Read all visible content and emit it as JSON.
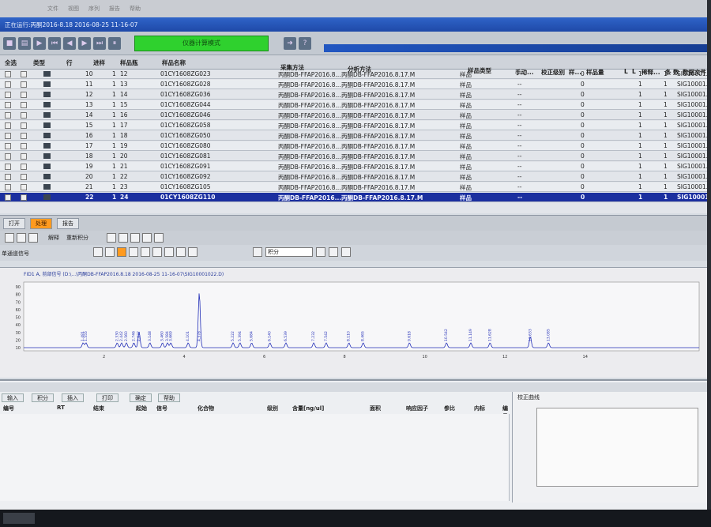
{
  "window": {
    "title": "正在运行:丙酮2016-8.18 2016-08-25 11-16-07",
    "mode_label": "仪器计算模式"
  },
  "grid": {
    "headers": [
      "全选",
      "类型",
      "行",
      "进样",
      "样品瓶",
      "样品名称",
      "采集方法",
      "分析方法",
      "样品类型",
      "手动...",
      "校正级别",
      "样...",
      "样品量",
      "L",
      "L",
      "稀释...",
      "条",
      "数",
      "数据文件"
    ],
    "rows": [
      {
        "line": "10",
        "inj": "1",
        "vial": "12",
        "name": "01CY1608ZG023",
        "acq": "丙酮DB-FFAP2016.8...",
        "ana": "丙酮DB-FFAP2016.8.17.M",
        "type": "样品",
        "amt": "0",
        "f1": "1",
        "f2": "1",
        "file": "SIG10001..."
      },
      {
        "line": "11",
        "inj": "1",
        "vial": "13",
        "name": "01CY1608ZG028",
        "acq": "丙酮DB-FFAP2016.8...",
        "ana": "丙酮DB-FFAP2016.8.17.M",
        "type": "样品",
        "amt": "0",
        "f1": "1",
        "f2": "1",
        "file": "SIG10001..."
      },
      {
        "line": "12",
        "inj": "1",
        "vial": "14",
        "name": "01CY1608ZG036",
        "acq": "丙酮DB-FFAP2016.8...",
        "ana": "丙酮DB-FFAP2016.8.17.M",
        "type": "样品",
        "amt": "0",
        "f1": "1",
        "f2": "1",
        "file": "SIG10001..."
      },
      {
        "line": "13",
        "inj": "1",
        "vial": "15",
        "name": "01CY1608ZG044",
        "acq": "丙酮DB-FFAP2016.8...",
        "ana": "丙酮DB-FFAP2016.8.17.M",
        "type": "样品",
        "amt": "0",
        "f1": "1",
        "f2": "1",
        "file": "SIG10001..."
      },
      {
        "line": "14",
        "inj": "1",
        "vial": "16",
        "name": "01CY1608ZG046",
        "acq": "丙酮DB-FFAP2016.8...",
        "ana": "丙酮DB-FFAP2016.8.17.M",
        "type": "样品",
        "amt": "0",
        "f1": "1",
        "f2": "1",
        "file": "SIG10001..."
      },
      {
        "line": "15",
        "inj": "1",
        "vial": "17",
        "name": "01CY1608ZG058",
        "acq": "丙酮DB-FFAP2016.8...",
        "ana": "丙酮DB-FFAP2016.8.17.M",
        "type": "样品",
        "amt": "0",
        "f1": "1",
        "f2": "1",
        "file": "SIG10001..."
      },
      {
        "line": "16",
        "inj": "1",
        "vial": "18",
        "name": "01CY1608ZG050",
        "acq": "丙酮DB-FFAP2016.8...",
        "ana": "丙酮DB-FFAP2016.8.17.M",
        "type": "样品",
        "amt": "0",
        "f1": "1",
        "f2": "1",
        "file": "SIG10001..."
      },
      {
        "line": "17",
        "inj": "1",
        "vial": "19",
        "name": "01CY1608ZG080",
        "acq": "丙酮DB-FFAP2016.8...",
        "ana": "丙酮DB-FFAP2016.8.17.M",
        "type": "样品",
        "amt": "0",
        "f1": "1",
        "f2": "1",
        "file": "SIG10001..."
      },
      {
        "line": "18",
        "inj": "1",
        "vial": "20",
        "name": "01CY1608ZG081",
        "acq": "丙酮DB-FFAP2016.8...",
        "ana": "丙酮DB-FFAP2016.8.17.M",
        "type": "样品",
        "amt": "0",
        "f1": "1",
        "f2": "1",
        "file": "SIG10001..."
      },
      {
        "line": "19",
        "inj": "1",
        "vial": "21",
        "name": "01CY1608ZG091",
        "acq": "丙酮DB-FFAP2016.8...",
        "ana": "丙酮DB-FFAP2016.8.17.M",
        "type": "样品",
        "amt": "0",
        "f1": "1",
        "f2": "1",
        "file": "SIG10001..."
      },
      {
        "line": "20",
        "inj": "1",
        "vial": "22",
        "name": "01CY1608ZG092",
        "acq": "丙酮DB-FFAP2016.8...",
        "ana": "丙酮DB-FFAP2016.8.17.M",
        "type": "样品",
        "amt": "0",
        "f1": "1",
        "f2": "1",
        "file": "SIG10001..."
      },
      {
        "line": "21",
        "inj": "1",
        "vial": "23",
        "name": "01CY1608ZG105",
        "acq": "丙酮DB-FFAP2016.8...",
        "ana": "丙酮DB-FFAP2016.8.17.M",
        "type": "样品",
        "amt": "0",
        "f1": "1",
        "f2": "1",
        "file": "SIG10001..."
      },
      {
        "line": "22",
        "inj": "1",
        "vial": "24",
        "name": "01CY1608ZG110",
        "acq": "丙酮DB-FFAP2016...",
        "ana": "丙酮DB-FFAP2016.8.17.M",
        "type": "样品",
        "amt": "0",
        "f1": "1",
        "f2": "1",
        "file": "SIG10001..."
      }
    ]
  },
  "tabs": [
    "打开",
    "处理",
    "报告"
  ],
  "toolbar2_labels": [
    "解释",
    "重新积分"
  ],
  "panel_label": "单通道信号",
  "combo_label": "积分",
  "chromatogram": {
    "title": "FID1 A, 前部信号 (D:\\...\\丙酮DB-FFAP2016.8.18 2016-08-25 11-16-07\\SIG10001022.D)",
    "y_ticks": [
      "90",
      "80",
      "70",
      "60",
      "50",
      "40",
      "30",
      "20",
      "10"
    ],
    "x_ticks": [
      "2",
      "4",
      "6",
      "8",
      "10",
      "12",
      "14"
    ],
    "peak_labels": [
      "1.481",
      "1.555",
      "2.330",
      "2.442",
      "2.560",
      "2.746",
      "2.877",
      "3.148",
      "3.460",
      "3.584",
      "3.669",
      "4.101",
      "4.378",
      "5.222",
      "5.394",
      "5.684",
      "6.140",
      "6.539",
      "7.232",
      "7.542",
      "8.110",
      "8.465",
      "9.618",
      "10.542",
      "11.149",
      "11.628",
      "12.633",
      "13.085"
    ]
  },
  "bottom": {
    "tabs": [
      "输入",
      "积分",
      "插入",
      "打印",
      "确定",
      "帮助"
    ],
    "columns": [
      "编号",
      "RT",
      "结束",
      "起始",
      "信号",
      "化合物",
      "级别",
      "含量[ng/ul]",
      "面积",
      "响应因子",
      "参比",
      "内标",
      "编号"
    ],
    "right_title": "校正曲线"
  }
}
